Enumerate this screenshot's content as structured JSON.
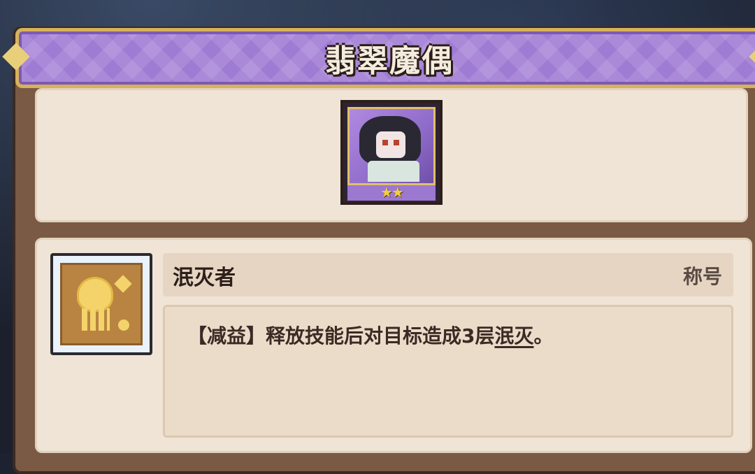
{
  "header": {
    "title": "翡翠魔偶"
  },
  "unit": {
    "stars": "★★",
    "portrait": "character-portrait"
  },
  "skill": {
    "icon": "sparkle-figure-icon",
    "name": "泯灭者",
    "tag": "称号",
    "desc_prefix": "【减益】释放技能后对目标造成3层",
    "desc_keyword": "泯灭",
    "desc_suffix": "。"
  },
  "colors": {
    "banner": "#9f7cd4",
    "banner_border": "#d7b25a",
    "panel": "#efe4d6",
    "frame": "#7a5a44",
    "star": "#f3cf3c",
    "icon_bg": "#b98442"
  }
}
